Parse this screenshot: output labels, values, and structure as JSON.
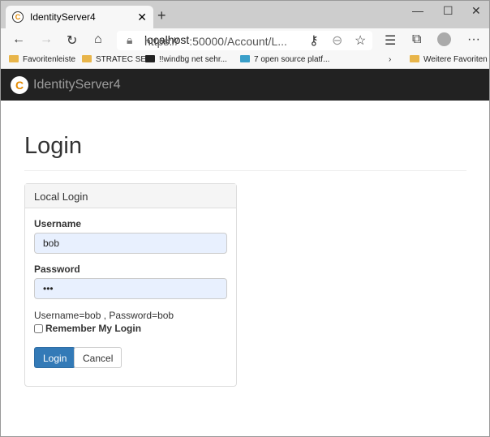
{
  "browser": {
    "tab_title": "IdentityServer4",
    "url_prefix": "https://",
    "url_host": "localhost",
    "url_rest": ":50000/Account/L...",
    "bookmarks": [
      "Favoritenleiste",
      "STRATEC SE",
      "!!windbg  net sehr...",
      "7 open source platf...",
      "Weitere Favoriten"
    ]
  },
  "app": {
    "brand": "IdentityServer4"
  },
  "page": {
    "title": "Login",
    "panel_title": "Local Login",
    "username_label": "Username",
    "username_value": "bob",
    "password_label": "Password",
    "password_value": "•••",
    "hint": "Username=bob , Password=bob",
    "remember_label": "Remember My Login",
    "login_button": "Login",
    "cancel_button": "Cancel"
  }
}
